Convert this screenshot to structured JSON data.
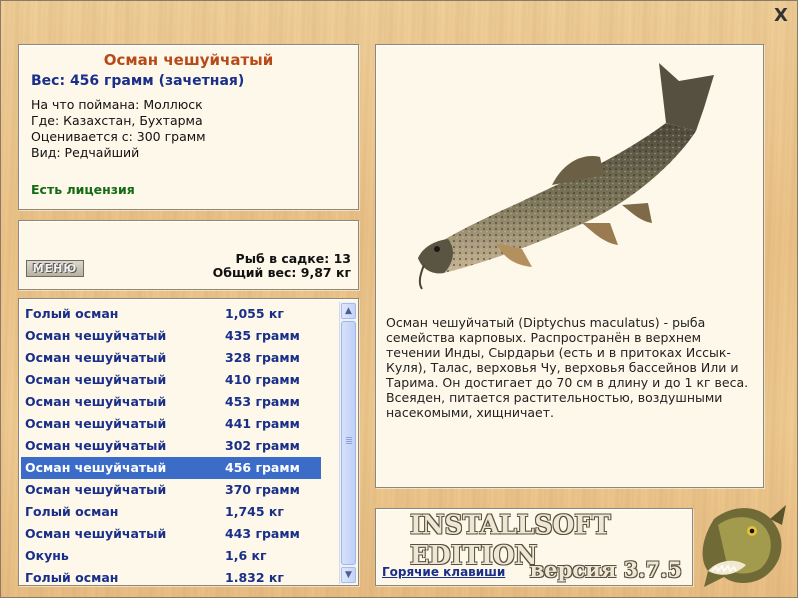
{
  "window": {
    "close_icon": "close-x-icon",
    "close_glyph": "X"
  },
  "fish_info": {
    "title": "Осман чешуйчатый",
    "weight": "Вес: 456 грамм (зачетная)",
    "caught_with": "На что поймана: Моллюск",
    "location": "Где: Казахстан, Бухтарма",
    "rated_from": "Оценивается с: 300 грамм",
    "rarity": "Вид: Редчайший",
    "license": "Есть лицензия"
  },
  "cage": {
    "menu_label": "МЕНЮ",
    "fish_count": "Рыб в садке: 13",
    "total_weight": "Общий вес: 9,87 кг"
  },
  "catch_list": [
    {
      "name": "Голый осман",
      "weight": "1,055 кг"
    },
    {
      "name": "Осман чешуйчатый",
      "weight": "435 грамм"
    },
    {
      "name": "Осман чешуйчатый",
      "weight": "328 грамм"
    },
    {
      "name": "Осман чешуйчатый",
      "weight": "410 грамм"
    },
    {
      "name": "Осман чешуйчатый",
      "weight": "453 грамм"
    },
    {
      "name": "Осман чешуйчатый",
      "weight": "441 грамм"
    },
    {
      "name": "Осман чешуйчатый",
      "weight": "302 грамм"
    },
    {
      "name": "Осман чешуйчатый",
      "weight": "456 грамм",
      "selected": true
    },
    {
      "name": "Осман чешуйчатый",
      "weight": "370 грамм"
    },
    {
      "name": "Голый осман",
      "weight": "1,745 кг"
    },
    {
      "name": "Осман чешуйчатый",
      "weight": "443 грамм"
    },
    {
      "name": "Окунь",
      "weight": "1,6 кг"
    },
    {
      "name": "Голый осман",
      "weight": "1.832 кг"
    }
  ],
  "description": "Осман чешуйчатый (Diptychus maculatus) - рыба семейства карповых. Распространён в верхнем течении Инды, Сырдарьи (есть и в притоках Иссык-Куля), Талас, верховья Чу, верховья бассейнов Или и Тарима. Он достигает до 70 см в длину и до 1 кг веса. Всеяден, питается растительностью, воздушными насекомыми, хищничает.",
  "brand": {
    "logo": "INSTALLSOFT EDITION",
    "hotkeys": "Горячие клавиши",
    "version": "версия 3.7.5"
  },
  "colors": {
    "title": "#b84a1a",
    "accent_blue": "#1a2f8a",
    "license_green": "#136b13",
    "selection": "#3a6cc8"
  }
}
